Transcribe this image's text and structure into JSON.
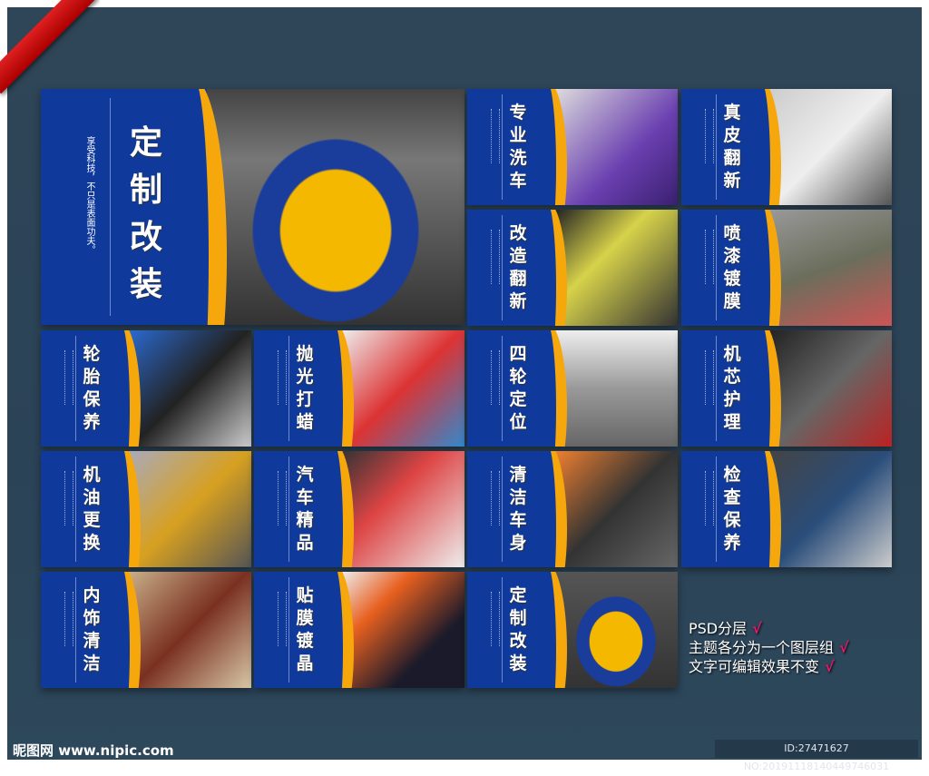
{
  "main": {
    "title": "定制改装",
    "subtitle": "享受科技，不只是表面功夫。"
  },
  "panels": [
    "专业洗车",
    "真皮翻新",
    "改造翻新",
    "喷漆镀膜",
    "轮胎保养",
    "抛光打蜡",
    "四轮定位",
    "机芯护理",
    "机油更换",
    "汽车精品",
    "清洁车身",
    "检查保养",
    "内饰清洁",
    "贴膜镀晶",
    "定制改装"
  ],
  "notes": [
    "PSD分层",
    "主题各分为一个图层组",
    "文字可编辑效果不变"
  ],
  "check": "√",
  "footer": {
    "logo": "昵图网 www.nipic.com",
    "id": "ID:27471627 NO:20191118140449746031"
  }
}
